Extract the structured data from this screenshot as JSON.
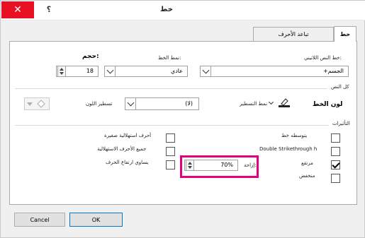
{
  "window": {
    "title": "خط",
    "help": "؟",
    "close": "✕"
  },
  "tabs": {
    "font": "خط",
    "advanced": "تباعد الأحرف"
  },
  "font_section": {
    "latin_font_label": "خط النص اللاتيني:",
    "latin_font_value": "+الجسم",
    "style_label": "نمط الخط:",
    "style_value": "عادي",
    "size_label": "حجم:",
    "size_value": "18"
  },
  "all_text": {
    "heading": "كل النص",
    "font_color_label": "لون الخط",
    "underline_style_label": "نمط التسطير",
    "underline_value": "(لا)",
    "underline_color_label": "تسطير اللون"
  },
  "effects": {
    "heading": "التأثيرات",
    "right": [
      {
        "label": "يتوسطه خط",
        "checked": false
      },
      {
        "label": "Double Strikethrough h",
        "checked": false
      },
      {
        "label": "مرتفع",
        "checked": true
      },
      {
        "label": "منخفض",
        "checked": false
      }
    ],
    "left": [
      {
        "label": "أحرف استهلالية صغيرة",
        "checked": false
      },
      {
        "label": "جميع الأحرف الاستهلالية",
        "checked": false
      },
      {
        "label": "يساوي ارتفاع الحرف",
        "checked": false
      }
    ],
    "offset_label": "إزاحة:",
    "offset_value": "70%"
  },
  "buttons": {
    "ok": "OK",
    "cancel": "Cancel"
  },
  "colors": {
    "accent": "#e4007c",
    "close": "#e81123"
  }
}
